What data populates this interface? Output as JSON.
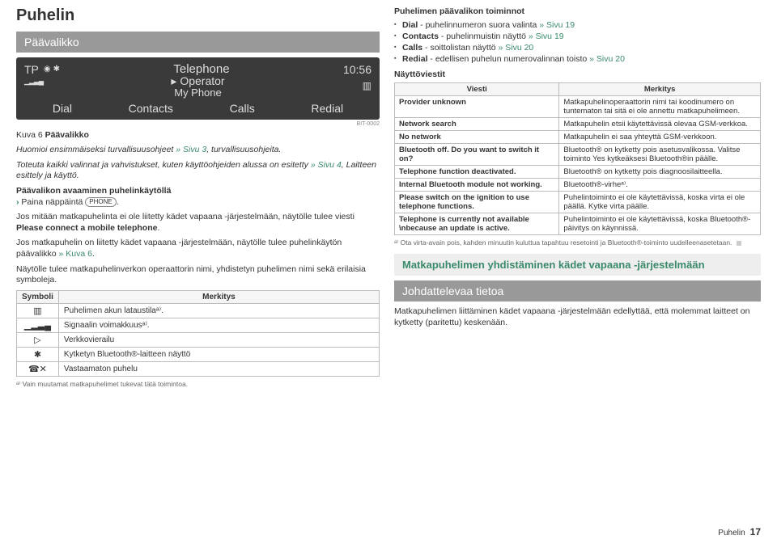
{
  "left": {
    "title": "Puhelin",
    "bar": "Päävalikko",
    "screenshot": {
      "tp": "TP",
      "telephone": "Telephone",
      "time": "10:56",
      "operator": "Operator",
      "myphone": "My Phone",
      "menu": {
        "dial": "Dial",
        "contacts": "Contacts",
        "calls": "Calls",
        "redial": "Redial"
      },
      "bitcode": "BIT-0002"
    },
    "caption_prefix": "Kuva 6",
    "caption_text": "Päävalikko",
    "para1_a": "Huomioi ensimmäiseksi turvallisuusohjeet",
    "para1_link": " » Sivu 3",
    "para1_b": ", turvallisuusohjeita.",
    "para2_a": "Toteuta kaikki valinnat ja vahvistukset, kuten käyttöohjeiden alussa on esitetty",
    "para2_link": " » Sivu 4",
    "para2_b": ", Laitteen esittely ja käyttö.",
    "para3_head": "Päävalikon avaaminen puhelinkäytöllä",
    "para3_item": "Paina näppäintä ",
    "keycap": "PHONE",
    "para3_item_end": ".",
    "para4_a": "Jos mitään matkapuhelinta ei ole liitetty kädet vapaana -järjestelmään, näytölle tulee viesti ",
    "para4_b": "Please connect a mobile telephone",
    "para4_c": ".",
    "para5_a": "Jos matkapuhelin on liitetty kädet vapaana -järjestelmään, näytölle tulee puhelinkäytön päävalikko",
    "para5_link": " » Kuva 6",
    "para5_b": ".",
    "para6": "Näytölle tulee matkapuhelinverkon operaattorin nimi, yhdistetyn puhelimen nimi sekä erilaisia symboleja.",
    "tbl_head_sym": "Symboli",
    "tbl_head_mean": "Merkitys",
    "rows": [
      {
        "s": "▥",
        "m": "Puhelimen akun lataustilaᵃ⁾."
      },
      {
        "s": "▁▂▃▄",
        "m": "Signaalin voimakkuusᵃ⁾."
      },
      {
        "s": "▷",
        "m": "Verkkovierailu"
      },
      {
        "s": "✱",
        "m": "Kytketyn Bluetooth®-laitteen näyttö"
      },
      {
        "s": "☎✕",
        "m": "Vastaamaton puhelu"
      }
    ],
    "footnote": "ᵃ⁾ Vain muutamat matkapuhelimet tukevat tätä toimintoa."
  },
  "right": {
    "head1": "Puhelimen päävalikon toiminnot",
    "items": [
      {
        "a": "Dial",
        "b": " - puhelinnumeron suora valinta",
        "l": " » Sivu 19"
      },
      {
        "a": "Contacts",
        "b": " - puhelinmuistin näyttö",
        "l": " » Sivu 19"
      },
      {
        "a": "Calls",
        "b": " - soittolistan näyttö",
        "l": " » Sivu 20"
      },
      {
        "a": "Redial",
        "b": " - edellisen puhelun numerovalinnan toisto",
        "l": " » Sivu 20"
      }
    ],
    "head2": "Näyttöviestit",
    "tbl_h1": "Viesti",
    "tbl_h2": "Merkitys",
    "msgs": [
      {
        "l": "Provider unknown",
        "r": "Matkapuhelinoperaattorin nimi tai koodinumero on tuntematon tai sitä ei ole annettu matkapuhelimeen."
      },
      {
        "l": "Network search",
        "r": "Matkapuhelin etsii käytettävissä olevaa GSM-verkkoa."
      },
      {
        "l": "No network",
        "r": "Matkapuhelin ei saa yhteyttä GSM-verkkoon."
      },
      {
        "l": "Bluetooth off. Do you want to switch it on?",
        "r": "Bluetooth® on kytketty pois asetusvalikossa. Valitse toiminto Yes kytkeäksesi Bluetooth®in päälle."
      },
      {
        "l": "Telephone function deactivated.",
        "r": "Bluetooth® on kytketty pois diagnoosilaitteella."
      },
      {
        "l": "Internal Bluetooth module not working.",
        "r": "Bluetooth®-virheᵃ⁾."
      },
      {
        "l": "Please switch on the ignition to use telephone functions.",
        "r": "Puhelintoiminto ei ole käytettävissä, koska virta ei ole päällä. Kytke virta päälle."
      },
      {
        "l": "Telephone is currently not available \\nbecause an update is active.",
        "r": "Puhelintoiminto ei ole käytettävissä, koska Bluetooth®-päivitys on käynnissä."
      }
    ],
    "footnote": "ᵃ⁾ Ota virta-avain pois, kahden minuutin kuluttua tapahtuu resetointi ja Bluetooth®-toiminto uudelleenasetetaan.",
    "section_head": "Matkapuhelimen yhdistäminen kädet vapaana -järjestelmään",
    "bar2": "Johdattelevaa tietoa",
    "para_last": "Matkapuhelimen liittäminen kädet vapaana -järjestelmään edellyttää, että molemmat laitteet on kytketty (paritettu) keskenään."
  },
  "foot": {
    "section": "Puhelin",
    "page": "17"
  }
}
